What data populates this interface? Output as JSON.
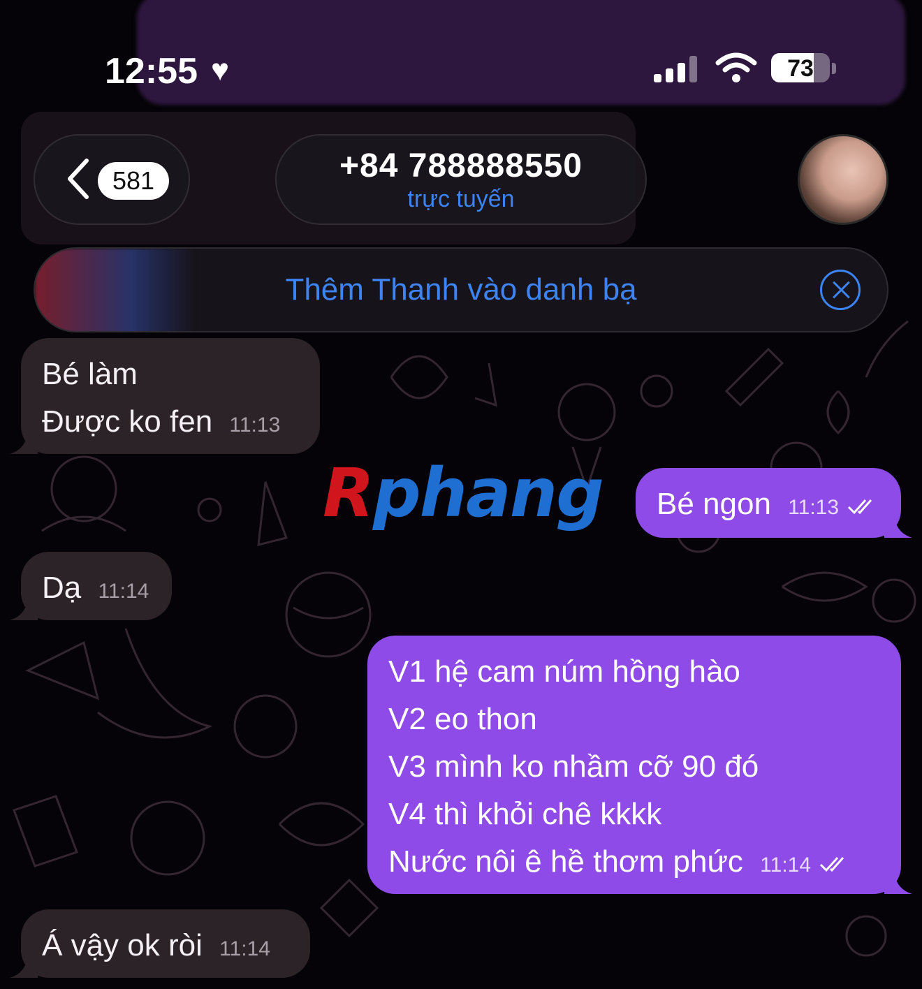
{
  "status_bar": {
    "time": "12:55",
    "battery": "73",
    "battery_level": 0.73
  },
  "header": {
    "back_count": "581",
    "contact_number": "+84 788888550",
    "contact_status": "trực tuyến"
  },
  "banner": {
    "text": "Thêm Thanh vào danh bạ"
  },
  "messages": [
    {
      "direction": "incoming",
      "lines": [
        "Bé làm",
        "Được ko fen"
      ],
      "time": "11:13"
    },
    {
      "direction": "outgoing",
      "lines": [
        "Bé ngon"
      ],
      "time": "11:13"
    },
    {
      "direction": "incoming",
      "lines": [
        "Dạ"
      ],
      "time": "11:14"
    },
    {
      "direction": "outgoing",
      "lines": [
        "V1 hệ cam núm hồng hào",
        "V2 eo thon",
        "V3 mình ko nhầm cỡ 90 đó",
        "V4 thì khỏi chê kkkk",
        "Nước nôi ê hề thơm phức"
      ],
      "time": "11:14"
    },
    {
      "direction": "incoming",
      "lines": [
        "Á vậy ok ròi"
      ],
      "time": "11:14"
    }
  ],
  "watermark": {
    "first": "R",
    "rest": "phang"
  },
  "colors": {
    "accent": "#3d84f2",
    "outgoing_bubble": "#8e4be8",
    "incoming_bubble": "#2c2328",
    "background": "#050307"
  }
}
